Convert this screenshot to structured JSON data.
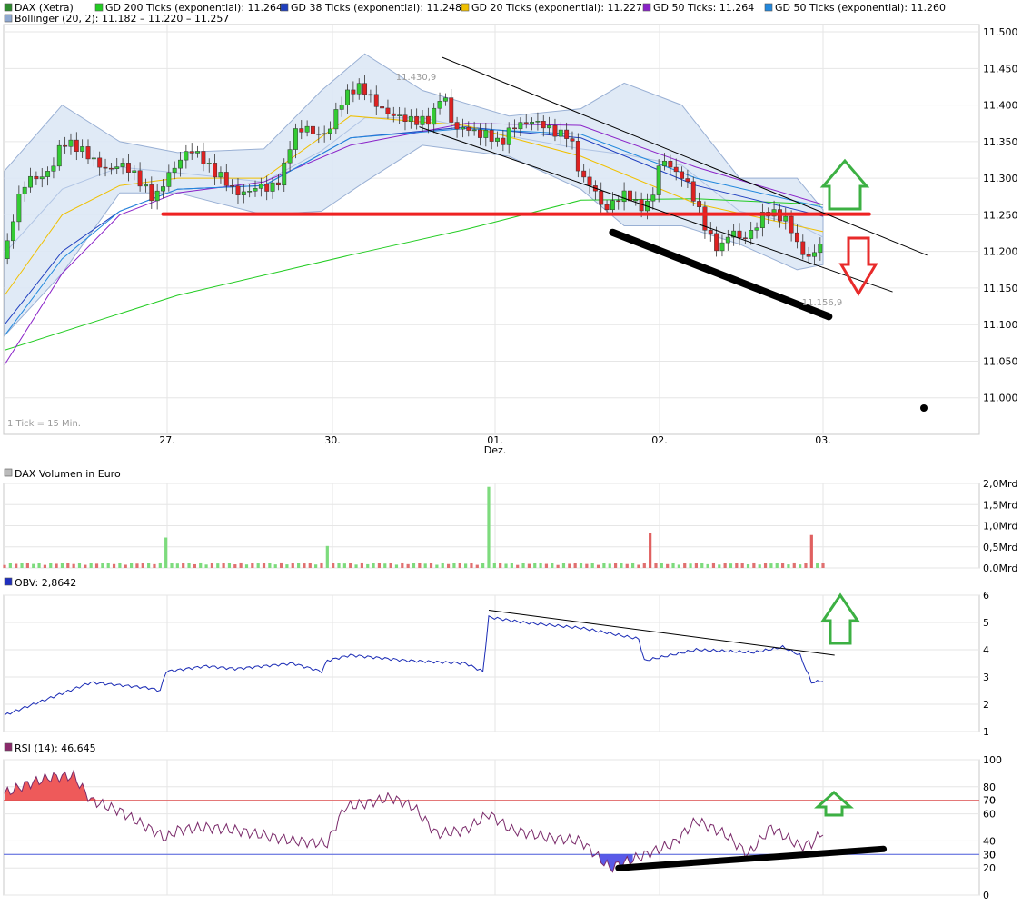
{
  "chart_data": [
    {
      "type": "candlestick",
      "panel": "price",
      "legend": [
        {
          "label": "DAX (Xetra)",
          "color": "#2e8b2e"
        },
        {
          "label": "GD 200 Ticks (exponential): 11.264",
          "color": "#22cc22"
        },
        {
          "label": "GD 38 Ticks (exponential): 11.248",
          "color": "#1f3fbf"
        },
        {
          "label": "GD 20 Ticks (exponential): 11.227",
          "color": "#f0c000"
        },
        {
          "label": "GD 50 Ticks: 11.264",
          "color": "#8a22c8"
        },
        {
          "label": "GD 50 Ticks (exponential): 11.260",
          "color": "#2288dd"
        },
        {
          "label": "Bollinger (20, 2): 11.182 – 11.220 – 11.257",
          "color": "#8fa8d0"
        }
      ],
      "ylim": [
        10950,
        11510
      ],
      "yticks": [
        "11.500",
        "11.450",
        "11.400",
        "11.350",
        "11.300",
        "11.250",
        "11.200",
        "11.150",
        "11.100",
        "11.050",
        "11.000"
      ],
      "ytick_values": [
        11500,
        11450,
        11400,
        11350,
        11300,
        11250,
        11200,
        11150,
        11100,
        11050,
        11000
      ],
      "xticks": [
        {
          "label": "27.",
          "sub": ""
        },
        {
          "label": "30.",
          "sub": ""
        },
        {
          "label": "01.",
          "sub": "Dez."
        },
        {
          "label": "02.",
          "sub": ""
        },
        {
          "label": "03.",
          "sub": ""
        }
      ],
      "tick_note": "1 Tick = 15 Min.",
      "annotations": {
        "high": "11.430,9",
        "low": "11.156,9"
      },
      "close_path": [
        [
          0,
          11190
        ],
        [
          4,
          11265
        ],
        [
          8,
          11300
        ],
        [
          12,
          11300
        ],
        [
          16,
          11310
        ],
        [
          20,
          11350
        ],
        [
          24,
          11345
        ],
        [
          28,
          11335
        ],
        [
          32,
          11320
        ],
        [
          36,
          11310
        ],
        [
          40,
          11320
        ],
        [
          44,
          11310
        ],
        [
          48,
          11290
        ],
        [
          52,
          11270
        ],
        [
          56,
          11300
        ],
        [
          60,
          11320
        ],
        [
          64,
          11340
        ],
        [
          68,
          11330
        ],
        [
          72,
          11310
        ],
        [
          76,
          11300
        ],
        [
          80,
          11280
        ],
        [
          84,
          11280
        ],
        [
          88,
          11290
        ],
        [
          92,
          11285
        ],
        [
          96,
          11300
        ],
        [
          100,
          11360
        ],
        [
          104,
          11370
        ],
        [
          108,
          11360
        ],
        [
          112,
          11360
        ],
        [
          116,
          11400
        ],
        [
          120,
          11420
        ],
        [
          124,
          11425
        ],
        [
          128,
          11405
        ],
        [
          132,
          11390
        ],
        [
          136,
          11385
        ],
        [
          140,
          11380
        ],
        [
          144,
          11378
        ],
        [
          148,
          11380
        ],
        [
          152,
          11420
        ],
        [
          156,
          11365
        ],
        [
          160,
          11370
        ],
        [
          164,
          11360
        ],
        [
          168,
          11360
        ],
        [
          172,
          11345
        ],
        [
          176,
          11370
        ],
        [
          180,
          11375
        ],
        [
          184,
          11378
        ],
        [
          188,
          11370
        ],
        [
          192,
          11360
        ],
        [
          196,
          11360
        ],
        [
          200,
          11300
        ],
        [
          204,
          11290
        ],
        [
          208,
          11255
        ],
        [
          212,
          11270
        ],
        [
          216,
          11280
        ],
        [
          220,
          11260
        ],
        [
          224,
          11265
        ],
        [
          228,
          11330
        ],
        [
          232,
          11310
        ],
        [
          236,
          11300
        ],
        [
          240,
          11265
        ],
        [
          244,
          11225
        ],
        [
          248,
          11200
        ],
        [
          252,
          11230
        ],
        [
          256,
          11215
        ],
        [
          260,
          11230
        ],
        [
          264,
          11255
        ],
        [
          268,
          11250
        ],
        [
          272,
          11240
        ],
        [
          276,
          11200
        ],
        [
          280,
          11190
        ],
        [
          284,
          11220
        ]
      ],
      "series": [
        {
          "name": "GD 200 Ticks (exponential)",
          "values": [
            [
              0,
              11065
            ],
            [
              60,
              11140
            ],
            [
              120,
              11195
            ],
            [
              160,
              11230
            ],
            [
              200,
              11270
            ],
            [
              240,
              11272
            ],
            [
              284,
              11264
            ]
          ]
        },
        {
          "name": "GD 38 Ticks (exponential)",
          "values": [
            [
              0,
              11100
            ],
            [
              20,
              11200
            ],
            [
              40,
              11255
            ],
            [
              60,
              11285
            ],
            [
              90,
              11290
            ],
            [
              120,
              11355
            ],
            [
              160,
              11370
            ],
            [
              200,
              11355
            ],
            [
              240,
              11290
            ],
            [
              284,
              11248
            ]
          ]
        },
        {
          "name": "GD 20 Ticks (exponential)",
          "values": [
            [
              0,
              11140
            ],
            [
              20,
              11250
            ],
            [
              40,
              11290
            ],
            [
              60,
              11300
            ],
            [
              90,
              11300
            ],
            [
              120,
              11385
            ],
            [
              160,
              11372
            ],
            [
              200,
              11330
            ],
            [
              240,
              11265
            ],
            [
              284,
              11227
            ]
          ]
        },
        {
          "name": "GD 50 Ticks",
          "values": [
            [
              0,
              11045
            ],
            [
              20,
              11170
            ],
            [
              40,
              11250
            ],
            [
              60,
              11280
            ],
            [
              90,
              11295
            ],
            [
              120,
              11345
            ],
            [
              160,
              11375
            ],
            [
              200,
              11372
            ],
            [
              240,
              11315
            ],
            [
              284,
              11264
            ]
          ]
        },
        {
          "name": "GD 50 Ticks (exponential)",
          "values": [
            [
              0,
              11085
            ],
            [
              20,
              11190
            ],
            [
              40,
              11255
            ],
            [
              60,
              11285
            ],
            [
              90,
              11290
            ],
            [
              120,
              11355
            ],
            [
              160,
              11368
            ],
            [
              200,
              11360
            ],
            [
              240,
              11300
            ],
            [
              284,
              11260
            ]
          ]
        },
        {
          "name": "Bollinger (20, 2)",
          "upper": [
            [
              0,
              11310
            ],
            [
              20,
              11400
            ],
            [
              40,
              11350
            ],
            [
              60,
              11335
            ],
            [
              90,
              11340
            ],
            [
              110,
              11420
            ],
            [
              125,
              11470
            ],
            [
              145,
              11420
            ],
            [
              175,
              11385
            ],
            [
              200,
              11395
            ],
            [
              215,
              11430
            ],
            [
              235,
              11400
            ],
            [
              255,
              11300
            ],
            [
              275,
              11300
            ],
            [
              284,
              11257
            ]
          ],
          "lower": [
            [
              0,
              11085
            ],
            [
              20,
              11170
            ],
            [
              40,
              11280
            ],
            [
              60,
              11280
            ],
            [
              90,
              11250
            ],
            [
              110,
              11255
            ],
            [
              125,
              11295
            ],
            [
              145,
              11345
            ],
            [
              175,
              11330
            ],
            [
              200,
              11285
            ],
            [
              215,
              11235
            ],
            [
              235,
              11235
            ],
            [
              255,
              11210
            ],
            [
              275,
              11175
            ],
            [
              284,
              11182
            ]
          ]
        }
      ],
      "drawings": [
        {
          "from": [
            55,
            11251
          ],
          "to": [
            300,
            11251
          ],
          "color": "#ee2222",
          "width": 4
        },
        {
          "from": [
            152,
            11465
          ],
          "to": [
            320,
            11195
          ],
          "color": "#000",
          "width": 1
        },
        {
          "from": [
            144,
            11370
          ],
          "to": [
            308,
            11145
          ],
          "color": "#000",
          "width": 1
        },
        {
          "from": [
            211,
            11226
          ],
          "to": [
            286,
            11111
          ],
          "color": "#000",
          "width": 8
        }
      ]
    },
    {
      "type": "bar",
      "panel": "volume",
      "title": "DAX Volumen in Euro",
      "ylim": [
        0,
        2.0
      ],
      "yticks": [
        "2,0Mrd",
        "1,5Mrd",
        "1,0Mrd",
        "0,5Mrd",
        "0,0Mrd"
      ],
      "ytick_values": [
        2.0,
        1.5,
        1.0,
        0.5,
        0.0
      ],
      "spikes": [
        [
          56,
          0.72
        ],
        [
          112,
          0.52
        ],
        [
          168,
          1.92
        ],
        [
          224,
          0.82
        ],
        [
          280,
          0.78
        ]
      ]
    },
    {
      "type": "line",
      "panel": "obv",
      "title": "OBV: 2,8642",
      "ylim": [
        1,
        6
      ],
      "yticks": [
        "6",
        "5",
        "4",
        "3",
        "2",
        "1"
      ],
      "ytick_values": [
        6,
        5,
        4,
        3,
        2,
        1
      ],
      "values": [
        [
          0,
          1.6
        ],
        [
          10,
          2.0
        ],
        [
          20,
          2.4
        ],
        [
          30,
          2.8
        ],
        [
          40,
          2.7
        ],
        [
          50,
          2.6
        ],
        [
          54,
          2.5
        ],
        [
          56,
          3.2
        ],
        [
          70,
          3.4
        ],
        [
          80,
          3.3
        ],
        [
          100,
          3.5
        ],
        [
          110,
          3.2
        ],
        [
          112,
          3.6
        ],
        [
          120,
          3.8
        ],
        [
          140,
          3.6
        ],
        [
          160,
          3.5
        ],
        [
          166,
          3.2
        ],
        [
          168,
          5.2
        ],
        [
          180,
          5.0
        ],
        [
          200,
          4.8
        ],
        [
          220,
          4.4
        ],
        [
          222,
          3.6
        ],
        [
          240,
          4.0
        ],
        [
          260,
          3.9
        ],
        [
          270,
          4.1
        ],
        [
          276,
          3.8
        ],
        [
          280,
          2.8
        ],
        [
          284,
          2.86
        ]
      ],
      "trendline": [
        [
          168,
          5.45
        ],
        [
          288,
          3.8
        ]
      ]
    },
    {
      "type": "line",
      "panel": "rsi",
      "title": "RSI (14): 46,645",
      "ylim": [
        0,
        100
      ],
      "yticks": [
        "100",
        "80",
        "70",
        "60",
        "40",
        "30",
        "20",
        "0"
      ],
      "ytick_values": [
        100,
        80,
        70,
        60,
        40,
        30,
        20,
        0
      ],
      "levels": [
        70,
        30
      ],
      "values": [
        [
          0,
          75
        ],
        [
          8,
          82
        ],
        [
          16,
          87
        ],
        [
          24,
          88
        ],
        [
          30,
          70
        ],
        [
          40,
          62
        ],
        [
          56,
          42
        ],
        [
          60,
          48
        ],
        [
          70,
          50
        ],
        [
          80,
          48
        ],
        [
          100,
          40
        ],
        [
          112,
          38
        ],
        [
          118,
          65
        ],
        [
          126,
          68
        ],
        [
          134,
          72
        ],
        [
          142,
          65
        ],
        [
          150,
          45
        ],
        [
          160,
          48
        ],
        [
          168,
          60
        ],
        [
          176,
          48
        ],
        [
          190,
          42
        ],
        [
          200,
          40
        ],
        [
          210,
          20
        ],
        [
          220,
          28
        ],
        [
          232,
          38
        ],
        [
          240,
          55
        ],
        [
          250,
          45
        ],
        [
          258,
          30
        ],
        [
          266,
          50
        ],
        [
          276,
          36
        ],
        [
          280,
          38
        ],
        [
          284,
          47
        ]
      ],
      "trendline": [
        [
          213,
          20
        ],
        [
          305,
          34
        ]
      ]
    }
  ]
}
